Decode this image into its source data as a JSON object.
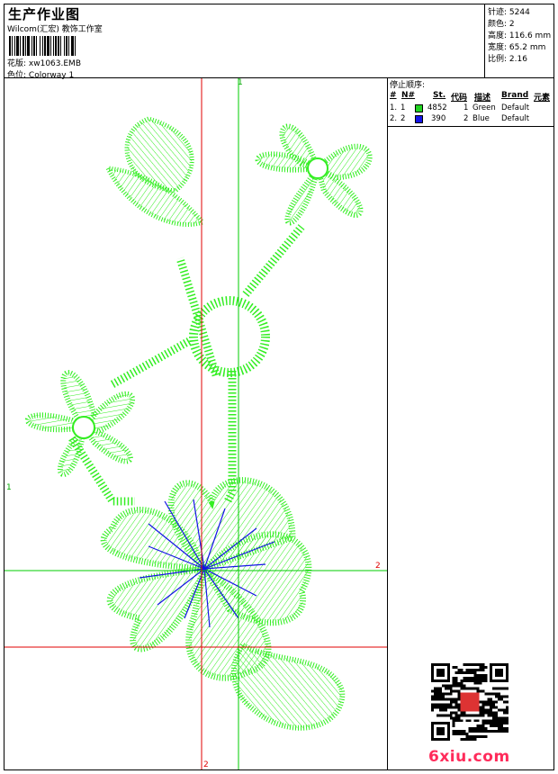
{
  "header": {
    "title": "生产作业图",
    "company": "Wilcom(汇宏) 教饰工作室",
    "design_label": "花版:",
    "design_value": "xw1063.EMB",
    "colorway_label": "色位:",
    "colorway_value": "Colorway 1"
  },
  "stats": [
    {
      "label": "针迹:",
      "value": "5244"
    },
    {
      "label": "颜色:",
      "value": "2"
    },
    {
      "label": "高度:",
      "value": "116.6 mm"
    },
    {
      "label": "宽度:",
      "value": "65.2 mm"
    },
    {
      "label": "比例:",
      "value": "2.16"
    }
  ],
  "sequence": {
    "title": "停止顺序:",
    "headers": {
      "index": "#",
      "needle": "N#",
      "stitches": "St.",
      "code": "代码",
      "desc": "描述",
      "brand": "Brand",
      "element": "元素"
    },
    "rows": [
      {
        "index": "1.",
        "needle": "1",
        "color": "#21d321",
        "stitches": "4852",
        "code": "1",
        "desc": "Green",
        "brand": "Default"
      },
      {
        "index": "2.",
        "needle": "2",
        "color": "#1414e6",
        "stitches": "390",
        "code": "2",
        "desc": "Blue",
        "brand": "Default"
      }
    ]
  },
  "axes": {
    "green_v_top": "1",
    "green_h_left": "1",
    "red_h_right": "2",
    "red_v_bottom": "2"
  },
  "colors": {
    "thread_green": "#33ee22",
    "thread_blue": "#1414e6",
    "axis_red": "#e00000",
    "axis_green": "#00cc00"
  },
  "watermark": "6xiu.com",
  "icons": [
    "barcode-icon",
    "qr-code-icon"
  ]
}
